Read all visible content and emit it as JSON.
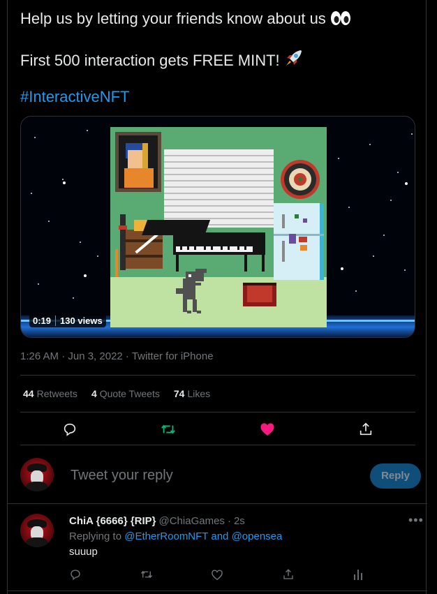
{
  "tweet": {
    "line1": "Help us by letting your friends know about us",
    "line2": "First 500 interaction gets FREE MINT!",
    "hashtag": "#InteractiveNFT",
    "emoji1": "eyes-emoji",
    "emoji2": "rocket-emoji"
  },
  "video": {
    "duration": "0:19",
    "views": "130 views"
  },
  "meta": "1:26 AM · Jun 3, 2022 · Twitter for iPhone",
  "stats": {
    "retweets_count": "44",
    "retweets_label": "Retweets",
    "quotes_count": "4",
    "quotes_label": "Quote Tweets",
    "likes_count": "74",
    "likes_label": "Likes"
  },
  "colors": {
    "accent": "#1d9bf0",
    "retweet_active": "#00ba7c",
    "like_active": "#f91880",
    "border": "#2f3336"
  },
  "compose": {
    "placeholder": "Tweet your reply",
    "button": "Reply"
  },
  "reply": {
    "name": "ChiA {6666} {RIP}",
    "handle": "@ChiaGames",
    "dot": "·",
    "time": "2s",
    "replying_prefix": "Replying to",
    "mention1": "@EtherRoomNFT",
    "and": "and",
    "mention2": "@opensea",
    "text": "suuup"
  }
}
